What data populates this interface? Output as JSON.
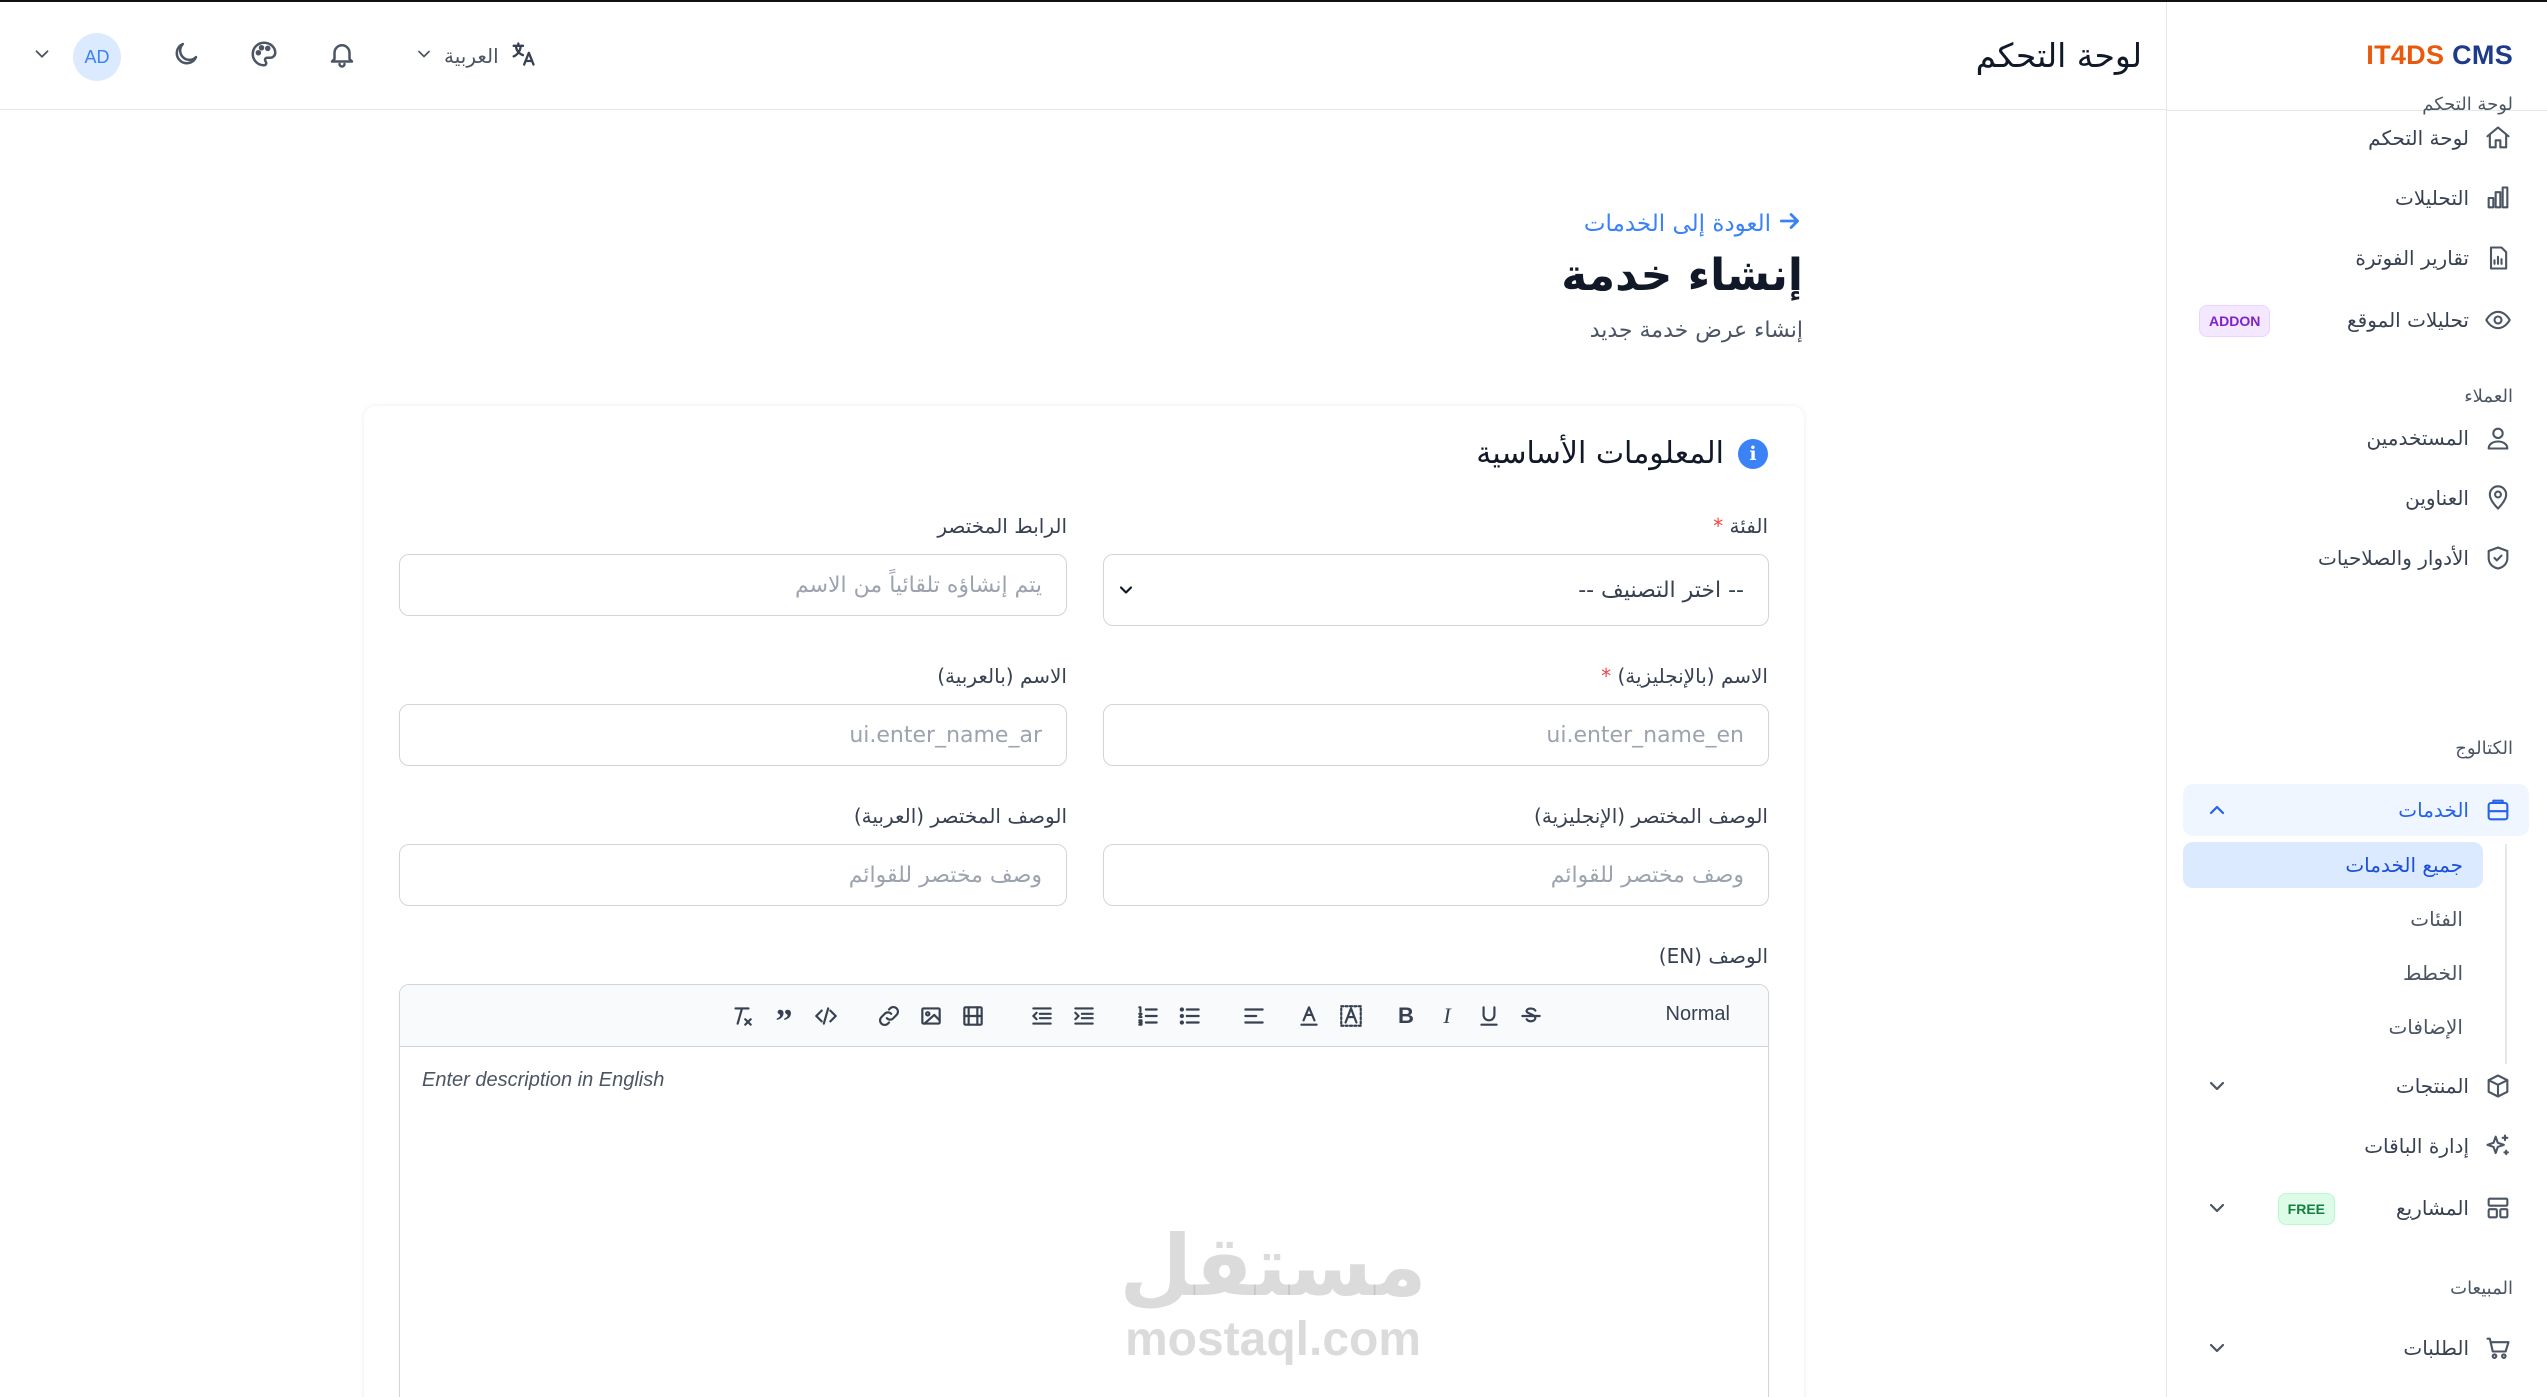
{
  "brand": {
    "part1": "IT4DS",
    "part2": " CMS"
  },
  "header": {
    "title": "لوحة التحكم",
    "language": "العربية",
    "avatar_initials": "AD"
  },
  "sidebar": {
    "sections": [
      {
        "title": "لوحة التحكم"
      },
      {
        "title": "العملاء"
      },
      {
        "title": "الكتالوج"
      },
      {
        "title": "المبيعات"
      }
    ],
    "items": [
      {
        "label": "لوحة التحكم",
        "icon": "home-icon"
      },
      {
        "label": "التحليلات",
        "icon": "bar-chart-icon"
      },
      {
        "label": "تقارير الفوترة",
        "icon": "report-icon"
      },
      {
        "label": "تحليلات الموقع",
        "icon": "eye-icon",
        "badge": "ADDON"
      },
      {
        "label": "المستخدمين",
        "icon": "users-icon"
      },
      {
        "label": "العناوين",
        "icon": "map-pin-icon"
      },
      {
        "label": "الأدوار والصلاحيات",
        "icon": "shield-icon"
      },
      {
        "label": "الخدمات",
        "icon": "inbox-icon",
        "active": true
      },
      {
        "label": "المنتجات",
        "icon": "box-icon"
      },
      {
        "label": "إدارة الباقات",
        "icon": "sparkles-icon"
      },
      {
        "label": "المشاريع",
        "icon": "layout-icon",
        "badge": "FREE"
      },
      {
        "label": "الطلبات",
        "icon": "cart-icon"
      }
    ],
    "sub_items": [
      {
        "label": "جميع الخدمات",
        "active": true
      },
      {
        "label": "الفئات"
      },
      {
        "label": "الخطط"
      },
      {
        "label": "الإضافات"
      }
    ]
  },
  "page": {
    "back_link": "العودة إلى الخدمات",
    "title": "إنشاء خدمة",
    "subtitle": "إنشاء عرض خدمة جديد"
  },
  "form": {
    "section_title": "المعلومات الأساسية",
    "category": {
      "label": "الفئة",
      "required": "*",
      "value": "-- اختر التصنيف --"
    },
    "slug": {
      "label": "الرابط المختصر",
      "placeholder": "يتم إنشاؤه تلقائياً من الاسم"
    },
    "name_en": {
      "label": "الاسم (بالإنجليزية)",
      "required": "*",
      "placeholder": "ui.enter_name_en"
    },
    "name_ar": {
      "label": "الاسم (بالعربية)",
      "placeholder": "ui.enter_name_ar"
    },
    "short_desc_en": {
      "label": "الوصف المختصر (الإنجليزية)",
      "placeholder": "وصف مختصر للقوائم"
    },
    "short_desc_ar": {
      "label": "الوصف المختصر (العربية)",
      "placeholder": "وصف مختصر للقوائم"
    },
    "description_en": {
      "label": "الوصف (EN)",
      "placeholder": "Enter description in English",
      "format_select": "Normal"
    }
  },
  "watermark": {
    "arabic": "مستقل",
    "latin": "mostaql.com"
  }
}
